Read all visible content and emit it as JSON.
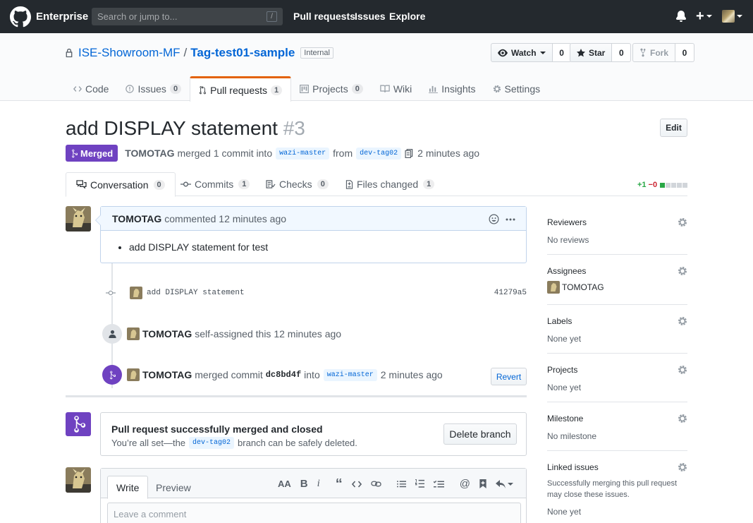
{
  "header": {
    "brand": "Enterprise",
    "search_placeholder": "Search or jump to...",
    "search_shortcut": "/",
    "nav": [
      "Pull requests",
      "Issues",
      "Explore"
    ],
    "plus": "+"
  },
  "repo": {
    "owner": "ISE-Showroom-MF",
    "separator": "/",
    "name": "Tag-test01-sample",
    "visibility": "Internal",
    "watch_label": "Watch",
    "watch_count": "0",
    "star_label": "Star",
    "star_count": "0",
    "fork_label": "Fork",
    "fork_count": "0",
    "tabs": [
      {
        "label": "Code",
        "count": ""
      },
      {
        "label": "Issues",
        "count": "0"
      },
      {
        "label": "Pull requests",
        "count": "1"
      },
      {
        "label": "Projects",
        "count": "0"
      },
      {
        "label": "Wiki",
        "count": ""
      },
      {
        "label": "Insights",
        "count": ""
      },
      {
        "label": "Settings",
        "count": ""
      }
    ]
  },
  "pr": {
    "title": "add DISPLAY statement",
    "number": "#3",
    "edit_label": "Edit",
    "state": "Merged",
    "author": "TOMOTAG",
    "merged_text": "merged 1 commit into",
    "base_branch": "wazi-master",
    "from_text": "from",
    "head_branch": "dev-tag02",
    "time": "2 minutes ago",
    "tabs": [
      {
        "label": "Conversation",
        "count": "0"
      },
      {
        "label": "Commits",
        "count": "1"
      },
      {
        "label": "Checks",
        "count": "0"
      },
      {
        "label": "Files changed",
        "count": "1"
      }
    ],
    "diff_add": "+1",
    "diff_del": "−0"
  },
  "timeline": {
    "comment_author": "TOMOTAG",
    "comment_meta": "commented 12 minutes ago",
    "comment_body": "add DISPLAY statement for test",
    "commit_message": "add DISPLAY statement",
    "commit_sha": "41279a5",
    "assign_author": "TOMOTAG",
    "assign_text": "self-assigned this 12 minutes ago",
    "merge_author": "TOMOTAG",
    "merge_text_1": "merged commit",
    "merge_commit": "dc8bd4f",
    "merge_text_2": "into",
    "merge_branch": "wazi-master",
    "merge_time": "2 minutes ago",
    "revert_label": "Revert"
  },
  "merged_box": {
    "title": "Pull request successfully merged and closed",
    "sub_1": "You’re all set—the",
    "branch": "dev-tag02",
    "sub_2": "branch can be safely deleted.",
    "delete_label": "Delete branch"
  },
  "editor": {
    "write_tab": "Write",
    "preview_tab": "Preview",
    "placeholder": "Leave a comment",
    "tool_heading": "AA",
    "tool_bold": "B",
    "tool_italic": "i",
    "tool_quote": "“",
    "tool_mention": "@"
  },
  "sidebar": [
    {
      "title": "Reviewers",
      "value": "No reviews"
    },
    {
      "title": "Assignees",
      "value": "TOMOTAG"
    },
    {
      "title": "Labels",
      "value": "None yet"
    },
    {
      "title": "Projects",
      "value": "None yet"
    },
    {
      "title": "Milestone",
      "value": "No milestone"
    },
    {
      "title": "Linked issues",
      "value": "Successfully merging this pull request may close these issues.",
      "value2": "None yet"
    }
  ],
  "colors": {
    "header_bg": "#24292e",
    "merged_purple": "#6f42c1",
    "link_blue": "#0366d6",
    "tab_accent": "#e36209",
    "diff_add": "#28a745",
    "diff_del": "#cb2431"
  }
}
